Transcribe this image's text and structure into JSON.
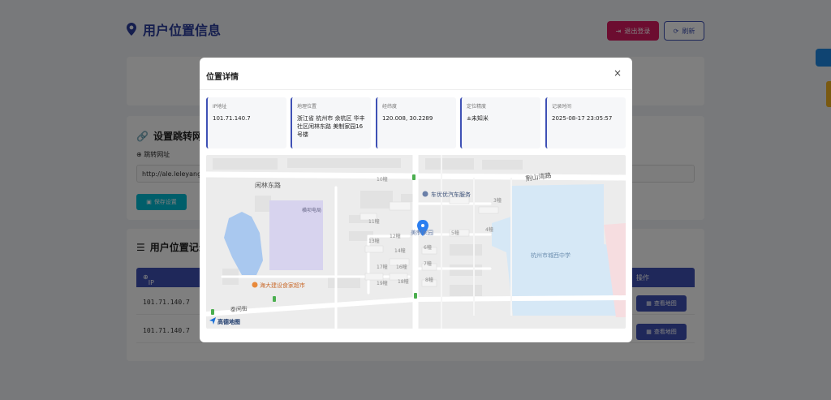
{
  "page": {
    "title": "用户位置信息",
    "logout_label": "退出登录",
    "refresh_label": "刷新"
  },
  "redirect": {
    "title": "设置跳转网址",
    "field_label": "跳转网址",
    "url_value": "http://ale.leleyangy",
    "save_label": "保存设置"
  },
  "records": {
    "title": "用户位置记录",
    "columns": [
      "IP 地址",
      "操作"
    ],
    "rows": [
      {
        "ip": "101.71.140.7",
        "action": "查看地图"
      },
      {
        "ip": "101.71.140.7",
        "action": "查看地图"
      }
    ]
  },
  "modal": {
    "title": "位置详情",
    "close": "×",
    "cards": [
      {
        "label": "IP地址",
        "value": "101.71.140.7"
      },
      {
        "label": "地理位置",
        "value": "浙江省 杭州市 余杭区 华丰社区闲林东路 美制家园16号楼"
      },
      {
        "label": "经纬度",
        "value": "120.008, 30.2289"
      },
      {
        "label": "定位精度",
        "value": "±未知米"
      },
      {
        "label": "记录时间",
        "value": "2025-08-17 23:05:57"
      }
    ]
  },
  "map": {
    "roads": [
      "闲林东路",
      "荆山湾路",
      "泰闲街"
    ],
    "pois": {
      "car_service": "车优优汽车服务",
      "school": "杭州市城西中学",
      "supermarket": "海大建设食家超市",
      "pin_label": "美制家园",
      "post_office": "横坝电局"
    },
    "buildings": [
      "10幢",
      "11幢",
      "12幢",
      "13幢",
      "14幢",
      "16幢",
      "17幢",
      "18幢",
      "19幢",
      "3幢",
      "4幢",
      "5幢",
      "6幢",
      "7幢",
      "8幢"
    ],
    "logo": "高德地图",
    "colors": {
      "water": "#a9c8ef",
      "school": "#d6e8f6",
      "campus": "#d7d3ee",
      "road": "#ffffff",
      "land": "#ececec",
      "pin": "#2a7ef0"
    }
  }
}
